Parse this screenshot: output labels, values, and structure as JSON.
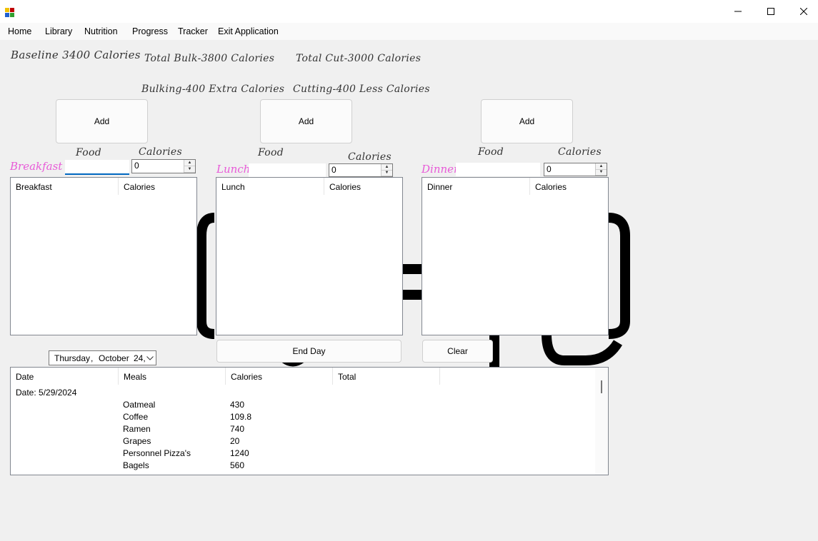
{
  "window": {
    "icon": "app-icon",
    "controls": {
      "minimize": "minimize-icon",
      "maximize": "maximize-icon",
      "close": "close-icon"
    }
  },
  "menu": [
    "Home",
    "Library",
    "Nutrition",
    "Progress",
    "Tracker",
    "Exit Application"
  ],
  "labels": {
    "baseline": "Baseline 3400 Calories",
    "total_bulk": "Total Bulk-3800 Calories",
    "total_cut": "Total Cut-3000 Calories",
    "bulking": "Bulking-400 Extra Calories",
    "cutting": "Cutting-400 Less Calories"
  },
  "meals": {
    "breakfast": {
      "title": "Breakfast",
      "add": "Add",
      "food_label": "Food",
      "calories_label": "Calories",
      "food_value": "",
      "calories_value": "0",
      "col1": "Breakfast",
      "col2": "Calories"
    },
    "lunch": {
      "title": "Lunch",
      "add": "Add",
      "food_label": "Food",
      "calories_label": "Calories",
      "food_value": "",
      "calories_value": "0",
      "col1": "Lunch",
      "col2": "Calories"
    },
    "dinner": {
      "title": "Dinner",
      "add": "Add",
      "food_label": "Food",
      "calories_label": "Calories",
      "food_value": "",
      "calories_value": "0",
      "col1": "Dinner",
      "col2": "Calories"
    }
  },
  "datepicker": {
    "day": "Thursday",
    "month": "October",
    "date": "24,"
  },
  "buttons": {
    "end_day": "End Day",
    "clear": "Clear"
  },
  "history": {
    "columns": [
      "Date",
      "Meals",
      "Calories",
      "Total"
    ],
    "date_row": "Date: 5/29/2024",
    "rows": [
      {
        "meal": "Oatmeal",
        "calories": "430"
      },
      {
        "meal": "Coffee",
        "calories": "109.8"
      },
      {
        "meal": "Ramen",
        "calories": "740"
      },
      {
        "meal": "Grapes",
        "calories": "20"
      },
      {
        "meal": "Personnel Pizza's",
        "calories": "1240"
      },
      {
        "meal": "Bagels",
        "calories": "560"
      }
    ]
  },
  "colors": {
    "meal_title": "#e85bd8",
    "background": "#f0f0f0"
  }
}
